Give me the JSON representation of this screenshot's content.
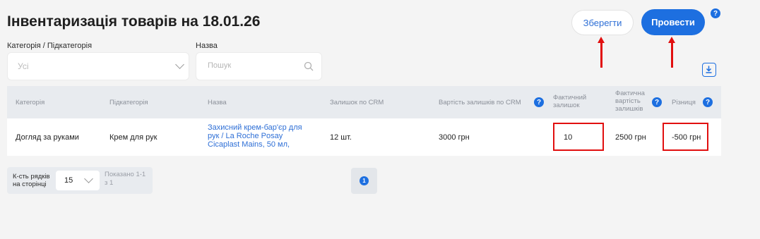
{
  "header": {
    "title": "Інвентаризація товарів на 18.01.26",
    "save_label": "Зберегти",
    "post_label": "Провести",
    "help": "?"
  },
  "filters": {
    "category_label": "Категорія / Підкатегорія",
    "category_value": "Усі",
    "name_label": "Назва",
    "search_placeholder": "Пошук"
  },
  "table": {
    "columns": [
      "Категорія",
      "Підкатегорія",
      "Назва",
      "Залишок по CRM",
      "Вартість залишків по CRM",
      "Фактичний залишок",
      "Фактична вартість залишків",
      "Різниця"
    ],
    "rows": [
      {
        "category": "Догляд за руками",
        "subcategory": "Крем для рук",
        "name": "Захисний крем-бар'єр для рук / La Roche Posay Cicaplast Mains, 50 мл,",
        "crm_stock": "12 шт.",
        "crm_value": "3000 грн",
        "actual_stock": "10",
        "actual_value": "2500 грн",
        "difference": "-500 грн"
      }
    ]
  },
  "pagination": {
    "rows_label": "К-сть рядків на сторінці",
    "rows_value": "15",
    "shown": "Показано 1-1 з 1",
    "current_page": "1"
  },
  "colors": {
    "accent": "#1d6fe0",
    "annotation": "#e10f0f"
  }
}
